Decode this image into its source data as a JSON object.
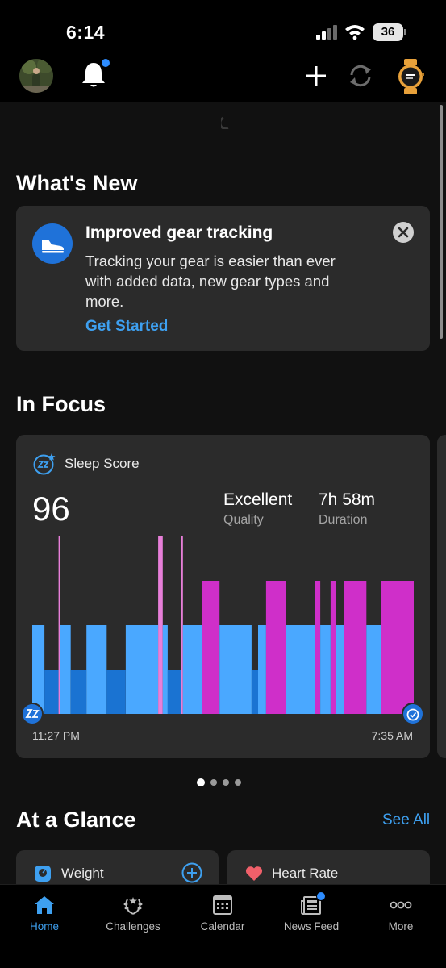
{
  "status_bar": {
    "time": "6:14",
    "battery": "36"
  },
  "header": {
    "icons": [
      "profile-avatar",
      "bell-icon",
      "plus-icon",
      "sync-icon",
      "watch-icon"
    ],
    "notification_dot": true
  },
  "whats_new": {
    "title": "What's New",
    "card": {
      "title": "Improved gear tracking",
      "body": "Tracking your gear is easier than ever with added data, new gear types and more.",
      "link": "Get Started"
    }
  },
  "in_focus": {
    "title": "In Focus",
    "card": {
      "label": "Sleep Score",
      "score": "96",
      "quality_value": "Excellent",
      "quality_label": "Quality",
      "duration_value": "7h 58m",
      "duration_label": "Duration",
      "start_time": "11:27 PM",
      "end_time": "7:35 AM"
    },
    "pager": {
      "count": 4,
      "active": 0
    }
  },
  "chart_data": {
    "type": "bar",
    "title": "Sleep Score",
    "x_range": [
      "11:27 PM",
      "7:35 AM"
    ],
    "levels": [
      "deep",
      "light",
      "rem",
      "awake"
    ],
    "level_colors": {
      "deep": "#1a73d2",
      "light": "#4aa8ff",
      "rem": "#cf2fc9",
      "awake": "#e87fd9"
    },
    "segments": [
      {
        "start": 0.0,
        "end": 0.032,
        "stage": "light"
      },
      {
        "start": 0.032,
        "end": 0.069,
        "stage": "deep"
      },
      {
        "start": 0.069,
        "end": 0.073,
        "stage": "awake"
      },
      {
        "start": 0.073,
        "end": 0.101,
        "stage": "light"
      },
      {
        "start": 0.101,
        "end": 0.142,
        "stage": "deep"
      },
      {
        "start": 0.142,
        "end": 0.195,
        "stage": "light"
      },
      {
        "start": 0.195,
        "end": 0.245,
        "stage": "deep"
      },
      {
        "start": 0.245,
        "end": 0.33,
        "stage": "light"
      },
      {
        "start": 0.33,
        "end": 0.342,
        "stage": "awake"
      },
      {
        "start": 0.342,
        "end": 0.355,
        "stage": "light"
      },
      {
        "start": 0.355,
        "end": 0.389,
        "stage": "deep"
      },
      {
        "start": 0.389,
        "end": 0.395,
        "stage": "awake"
      },
      {
        "start": 0.395,
        "end": 0.444,
        "stage": "light"
      },
      {
        "start": 0.444,
        "end": 0.491,
        "stage": "rem"
      },
      {
        "start": 0.491,
        "end": 0.575,
        "stage": "light"
      },
      {
        "start": 0.575,
        "end": 0.592,
        "stage": "deep"
      },
      {
        "start": 0.592,
        "end": 0.613,
        "stage": "light"
      },
      {
        "start": 0.613,
        "end": 0.664,
        "stage": "rem"
      },
      {
        "start": 0.664,
        "end": 0.74,
        "stage": "light"
      },
      {
        "start": 0.74,
        "end": 0.755,
        "stage": "rem"
      },
      {
        "start": 0.755,
        "end": 0.782,
        "stage": "light"
      },
      {
        "start": 0.782,
        "end": 0.795,
        "stage": "rem"
      },
      {
        "start": 0.795,
        "end": 0.817,
        "stage": "light"
      },
      {
        "start": 0.817,
        "end": 0.876,
        "stage": "rem"
      },
      {
        "start": 0.876,
        "end": 0.915,
        "stage": "light"
      },
      {
        "start": 0.915,
        "end": 1.0,
        "stage": "rem"
      }
    ]
  },
  "at_a_glance": {
    "title": "At a Glance",
    "see_all": "See All",
    "cards": [
      {
        "label": "Weight",
        "icon": "scale-icon"
      },
      {
        "label": "Heart Rate",
        "icon": "heart-icon"
      }
    ]
  },
  "tabs": [
    {
      "label": "Home",
      "icon": "home-icon",
      "active": true
    },
    {
      "label": "Challenges",
      "icon": "laurel-icon",
      "active": false
    },
    {
      "label": "Calendar",
      "icon": "calendar-icon",
      "active": false
    },
    {
      "label": "News Feed",
      "icon": "newspaper-icon",
      "active": false
    },
    {
      "label": "More",
      "icon": "more-icon",
      "active": false
    }
  ],
  "colors": {
    "accent": "#3ea0f0",
    "brand_blue": "#1f72d9"
  }
}
